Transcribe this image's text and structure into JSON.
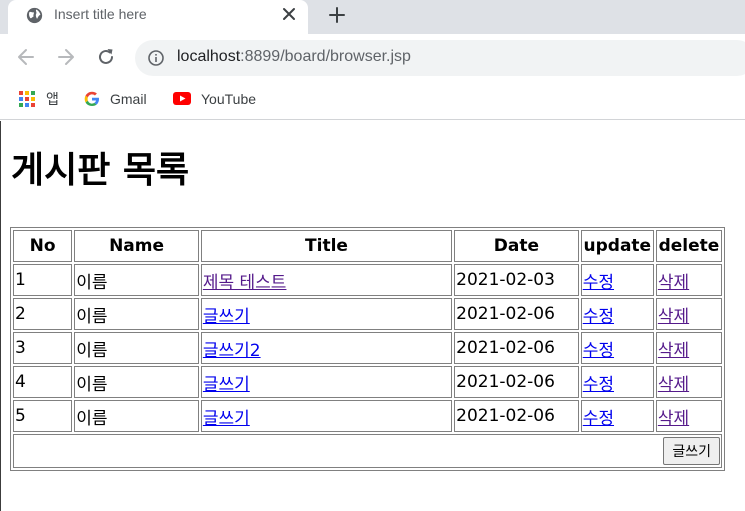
{
  "browser": {
    "tab_title": "Insert title here",
    "url_host": "localhost",
    "url_path": ":8899/board/browser.jsp",
    "bookmarks": [
      {
        "label": "앱",
        "icon": "apps-grid-icon"
      },
      {
        "label": "Gmail",
        "icon": "google-icon"
      },
      {
        "label": "YouTube",
        "icon": "youtube-icon"
      }
    ]
  },
  "page": {
    "heading": "게시판 목록",
    "columns": [
      "No",
      "Name",
      "Title",
      "Date",
      "update",
      "delete"
    ],
    "rows": [
      {
        "no": "1",
        "name": "이름",
        "title": "제목 테스트",
        "date": "2021-02-03",
        "update": "수정",
        "delete": "삭제"
      },
      {
        "no": "2",
        "name": "이름",
        "title": "글쓰기",
        "date": "2021-02-06",
        "update": "수정",
        "delete": "삭제"
      },
      {
        "no": "3",
        "name": "이름",
        "title": "글쓰기2",
        "date": "2021-02-06",
        "update": "수정",
        "delete": "삭제"
      },
      {
        "no": "4",
        "name": "이름",
        "title": "글쓰기",
        "date": "2021-02-06",
        "update": "수정",
        "delete": "삭제"
      },
      {
        "no": "5",
        "name": "이름",
        "title": "글쓰기",
        "date": "2021-02-06",
        "update": "수정",
        "delete": "삭제"
      }
    ],
    "write_button": "글쓰기"
  },
  "colors": {
    "link": "#0000ee",
    "visited_link": "#551a8b",
    "tabstrip": "#dee1e6",
    "omnibox": "#f1f3f4"
  }
}
